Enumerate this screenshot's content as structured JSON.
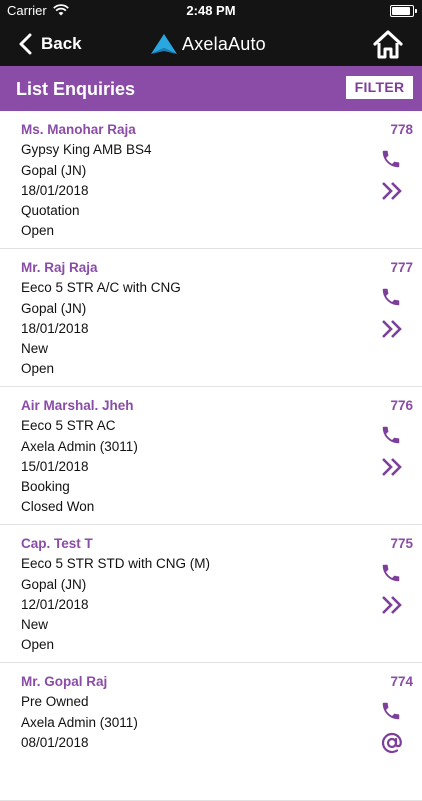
{
  "status_bar": {
    "carrier": "Carrier",
    "time": "2:48 PM"
  },
  "nav": {
    "back_label": "Back",
    "brand": "AxelaAuto"
  },
  "header": {
    "title": "List Enquiries",
    "filter_label": "FILTER"
  },
  "enquiries": [
    {
      "name": "Ms. Manohar Raja",
      "number": "778",
      "model": "Gypsy King AMB BS4",
      "executive": "Gopal (JN)",
      "date": "18/01/2018",
      "stage": "Quotation",
      "status": "Open",
      "actions": [
        "phone-icon",
        "double-chevron-icon"
      ]
    },
    {
      "name": "Mr. Raj Raja",
      "number": "777",
      "model": "Eeco 5 STR A/C with CNG",
      "executive": "Gopal (JN)",
      "date": "18/01/2018",
      "stage": "New",
      "status": "Open",
      "actions": [
        "phone-icon",
        "double-chevron-icon"
      ]
    },
    {
      "name": "Air Marshal. Jheh",
      "number": "776",
      "model": "Eeco 5 STR AC",
      "executive": "Axela Admin (3011)",
      "date": "15/01/2018",
      "stage": "Booking",
      "status": "Closed Won",
      "actions": [
        "phone-icon",
        "double-chevron-icon"
      ]
    },
    {
      "name": "Cap. Test T",
      "number": "775",
      "model": "Eeco 5 STR STD with CNG (M)",
      "executive": "Gopal (JN)",
      "date": "12/01/2018",
      "stage": "New",
      "status": "Open",
      "actions": [
        "phone-icon",
        "double-chevron-icon"
      ]
    },
    {
      "name": "Mr. Gopal Raj",
      "number": "774",
      "model": "Pre Owned",
      "executive": "Axela Admin (3011)",
      "date": "08/01/2018",
      "stage": "",
      "status": "",
      "actions": [
        "phone-icon",
        "at-icon"
      ]
    }
  ],
  "colors": {
    "accent": "#8a4ca7",
    "icon": "#7e3f9b",
    "nav_bg": "#141414",
    "brand_blue": "#2aa6e0"
  }
}
